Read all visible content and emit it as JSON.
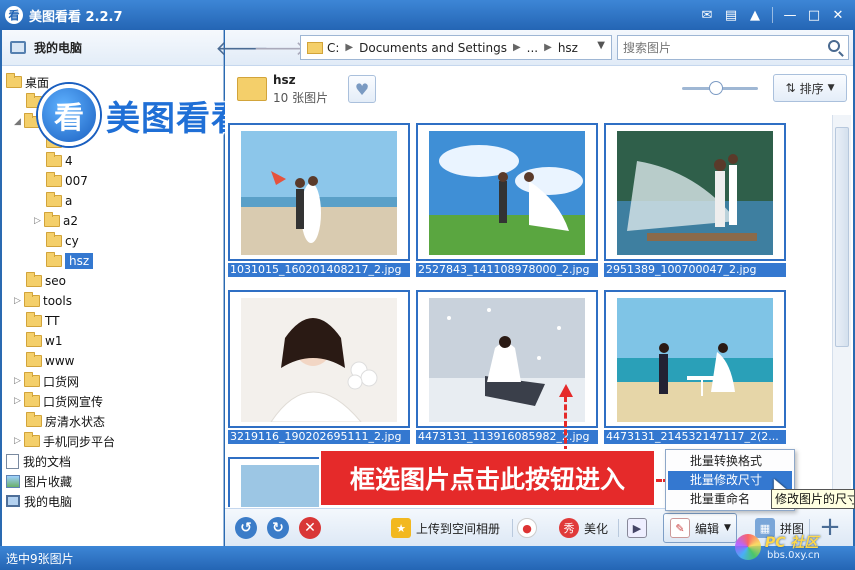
{
  "window": {
    "title": "美图看看 2.2.7",
    "app_icon": "看"
  },
  "sidebar": {
    "header": "我的电脑",
    "tree": [
      {
        "label": "桌面",
        "icon": "folder"
      },
      {
        "label": "4",
        "icon": "folder"
      },
      {
        "label": "007",
        "icon": "folder"
      },
      {
        "label": "a",
        "icon": "folder"
      },
      {
        "label": "a2",
        "icon": "folder"
      },
      {
        "label": "cy",
        "icon": "folder"
      },
      {
        "label": "hsz",
        "icon": "folder",
        "selected": true
      },
      {
        "label": "seo",
        "icon": "folder"
      },
      {
        "label": "tools",
        "icon": "folder"
      },
      {
        "label": "TT",
        "icon": "folder"
      },
      {
        "label": "w1",
        "icon": "folder"
      },
      {
        "label": "www",
        "icon": "folder"
      },
      {
        "label": "口货网",
        "icon": "folder"
      },
      {
        "label": "口货网宣传",
        "icon": "folder"
      },
      {
        "label": "房清水状态",
        "icon": "folder"
      },
      {
        "label": "手机同步平台",
        "icon": "folder"
      },
      {
        "label": "我的文档",
        "icon": "document"
      },
      {
        "label": "图片收藏",
        "icon": "pictures"
      },
      {
        "label": "我的电脑",
        "icon": "computer"
      }
    ]
  },
  "logo": {
    "badge": "看",
    "text": "美图看看"
  },
  "nav": {
    "path": [
      "C:",
      "Documents and Settings",
      "...",
      "hsz"
    ],
    "search_placeholder": "搜索图片"
  },
  "folder_info": {
    "name": "hsz",
    "count": "10 张图片"
  },
  "zoom": {
    "level": 0.45
  },
  "sort_label": "排序",
  "thumbnails": [
    {
      "file": "1031015_160201408217_2.jpg"
    },
    {
      "file": "2527843_141108978000_2.jpg"
    },
    {
      "file": "2951389_100700047_2.jpg"
    },
    {
      "file": "3219116_190202695111_2.jpg"
    },
    {
      "file": "4473131_113916085982_2.jpg"
    },
    {
      "file": "4473131_214532147117_2(2..."
    }
  ],
  "toolbar": {
    "upload": "上传到空间相册",
    "beautify": "美化",
    "beautify_icon": "秀",
    "edit": "编辑",
    "collage": "拼图"
  },
  "context_menu": {
    "items": [
      "批量转换格式",
      "批量修改尺寸",
      "批量重命名"
    ],
    "highlighted": 1
  },
  "tooltip": "修改图片的尺寸",
  "annotation": "框选图片点击此按钮进入",
  "status": "选中9张图片",
  "watermark": {
    "brand": "PC 社区",
    "site": "bbs.0xy.cn"
  },
  "colors": {
    "titlebar": "#2a6ab1",
    "selection": "#3478d0",
    "annotation": "#e52a2a"
  }
}
